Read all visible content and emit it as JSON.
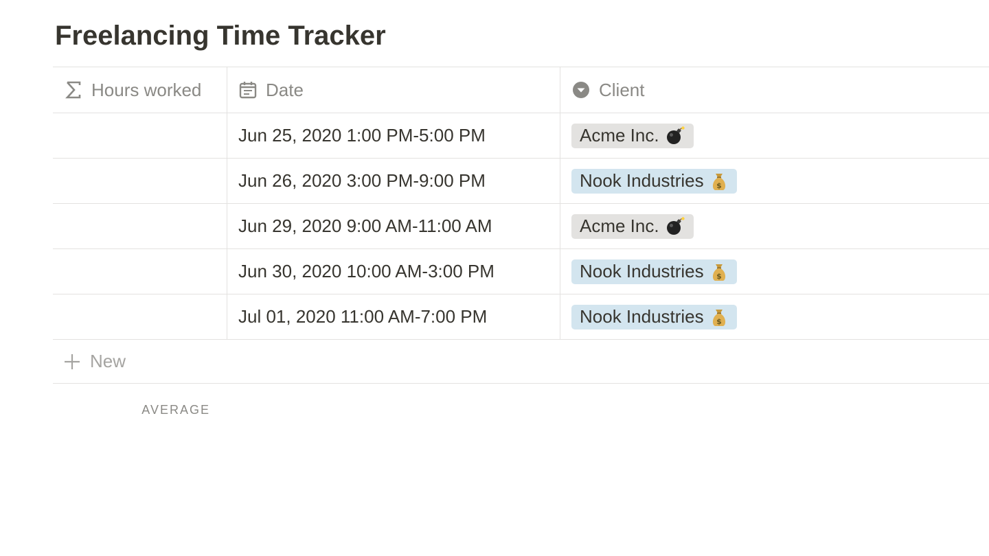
{
  "page": {
    "title": "Freelancing Time Tracker"
  },
  "table": {
    "columns": [
      {
        "label": "Hours worked",
        "icon": "sigma-icon"
      },
      {
        "label": "Date",
        "icon": "calendar-icon"
      },
      {
        "label": "Client",
        "icon": "select-dropdown-icon"
      }
    ],
    "rows": [
      {
        "hours": "",
        "date": "Jun 25, 2020 1:00 PM-5:00 PM",
        "client": "Acme Inc.",
        "client_emoji": "bomb-icon",
        "client_color": "#e3e2e0"
      },
      {
        "hours": "",
        "date": "Jun 26, 2020 3:00 PM-9:00 PM",
        "client": "Nook Industries",
        "client_emoji": "money-bag-icon",
        "client_color": "#d3e5ef"
      },
      {
        "hours": "",
        "date": "Jun 29, 2020 9:00 AM-11:00 AM",
        "client": "Acme Inc.",
        "client_emoji": "bomb-icon",
        "client_color": "#e3e2e0"
      },
      {
        "hours": "",
        "date": "Jun 30, 2020 10:00 AM-3:00 PM",
        "client": "Nook Industries",
        "client_emoji": "money-bag-icon",
        "client_color": "#d3e5ef"
      },
      {
        "hours": "",
        "date": "Jul 01, 2020 11:00 AM-7:00 PM",
        "client": "Nook Industries",
        "client_emoji": "money-bag-icon",
        "client_color": "#d3e5ef"
      }
    ],
    "new_label": "New",
    "calculation_label": "AVERAGE"
  },
  "colors": {
    "text": "#37352f",
    "muted": "#8a8985",
    "border": "#e3e2e0",
    "tag_gray": "#e3e2e0",
    "tag_blue": "#d3e5ef"
  }
}
